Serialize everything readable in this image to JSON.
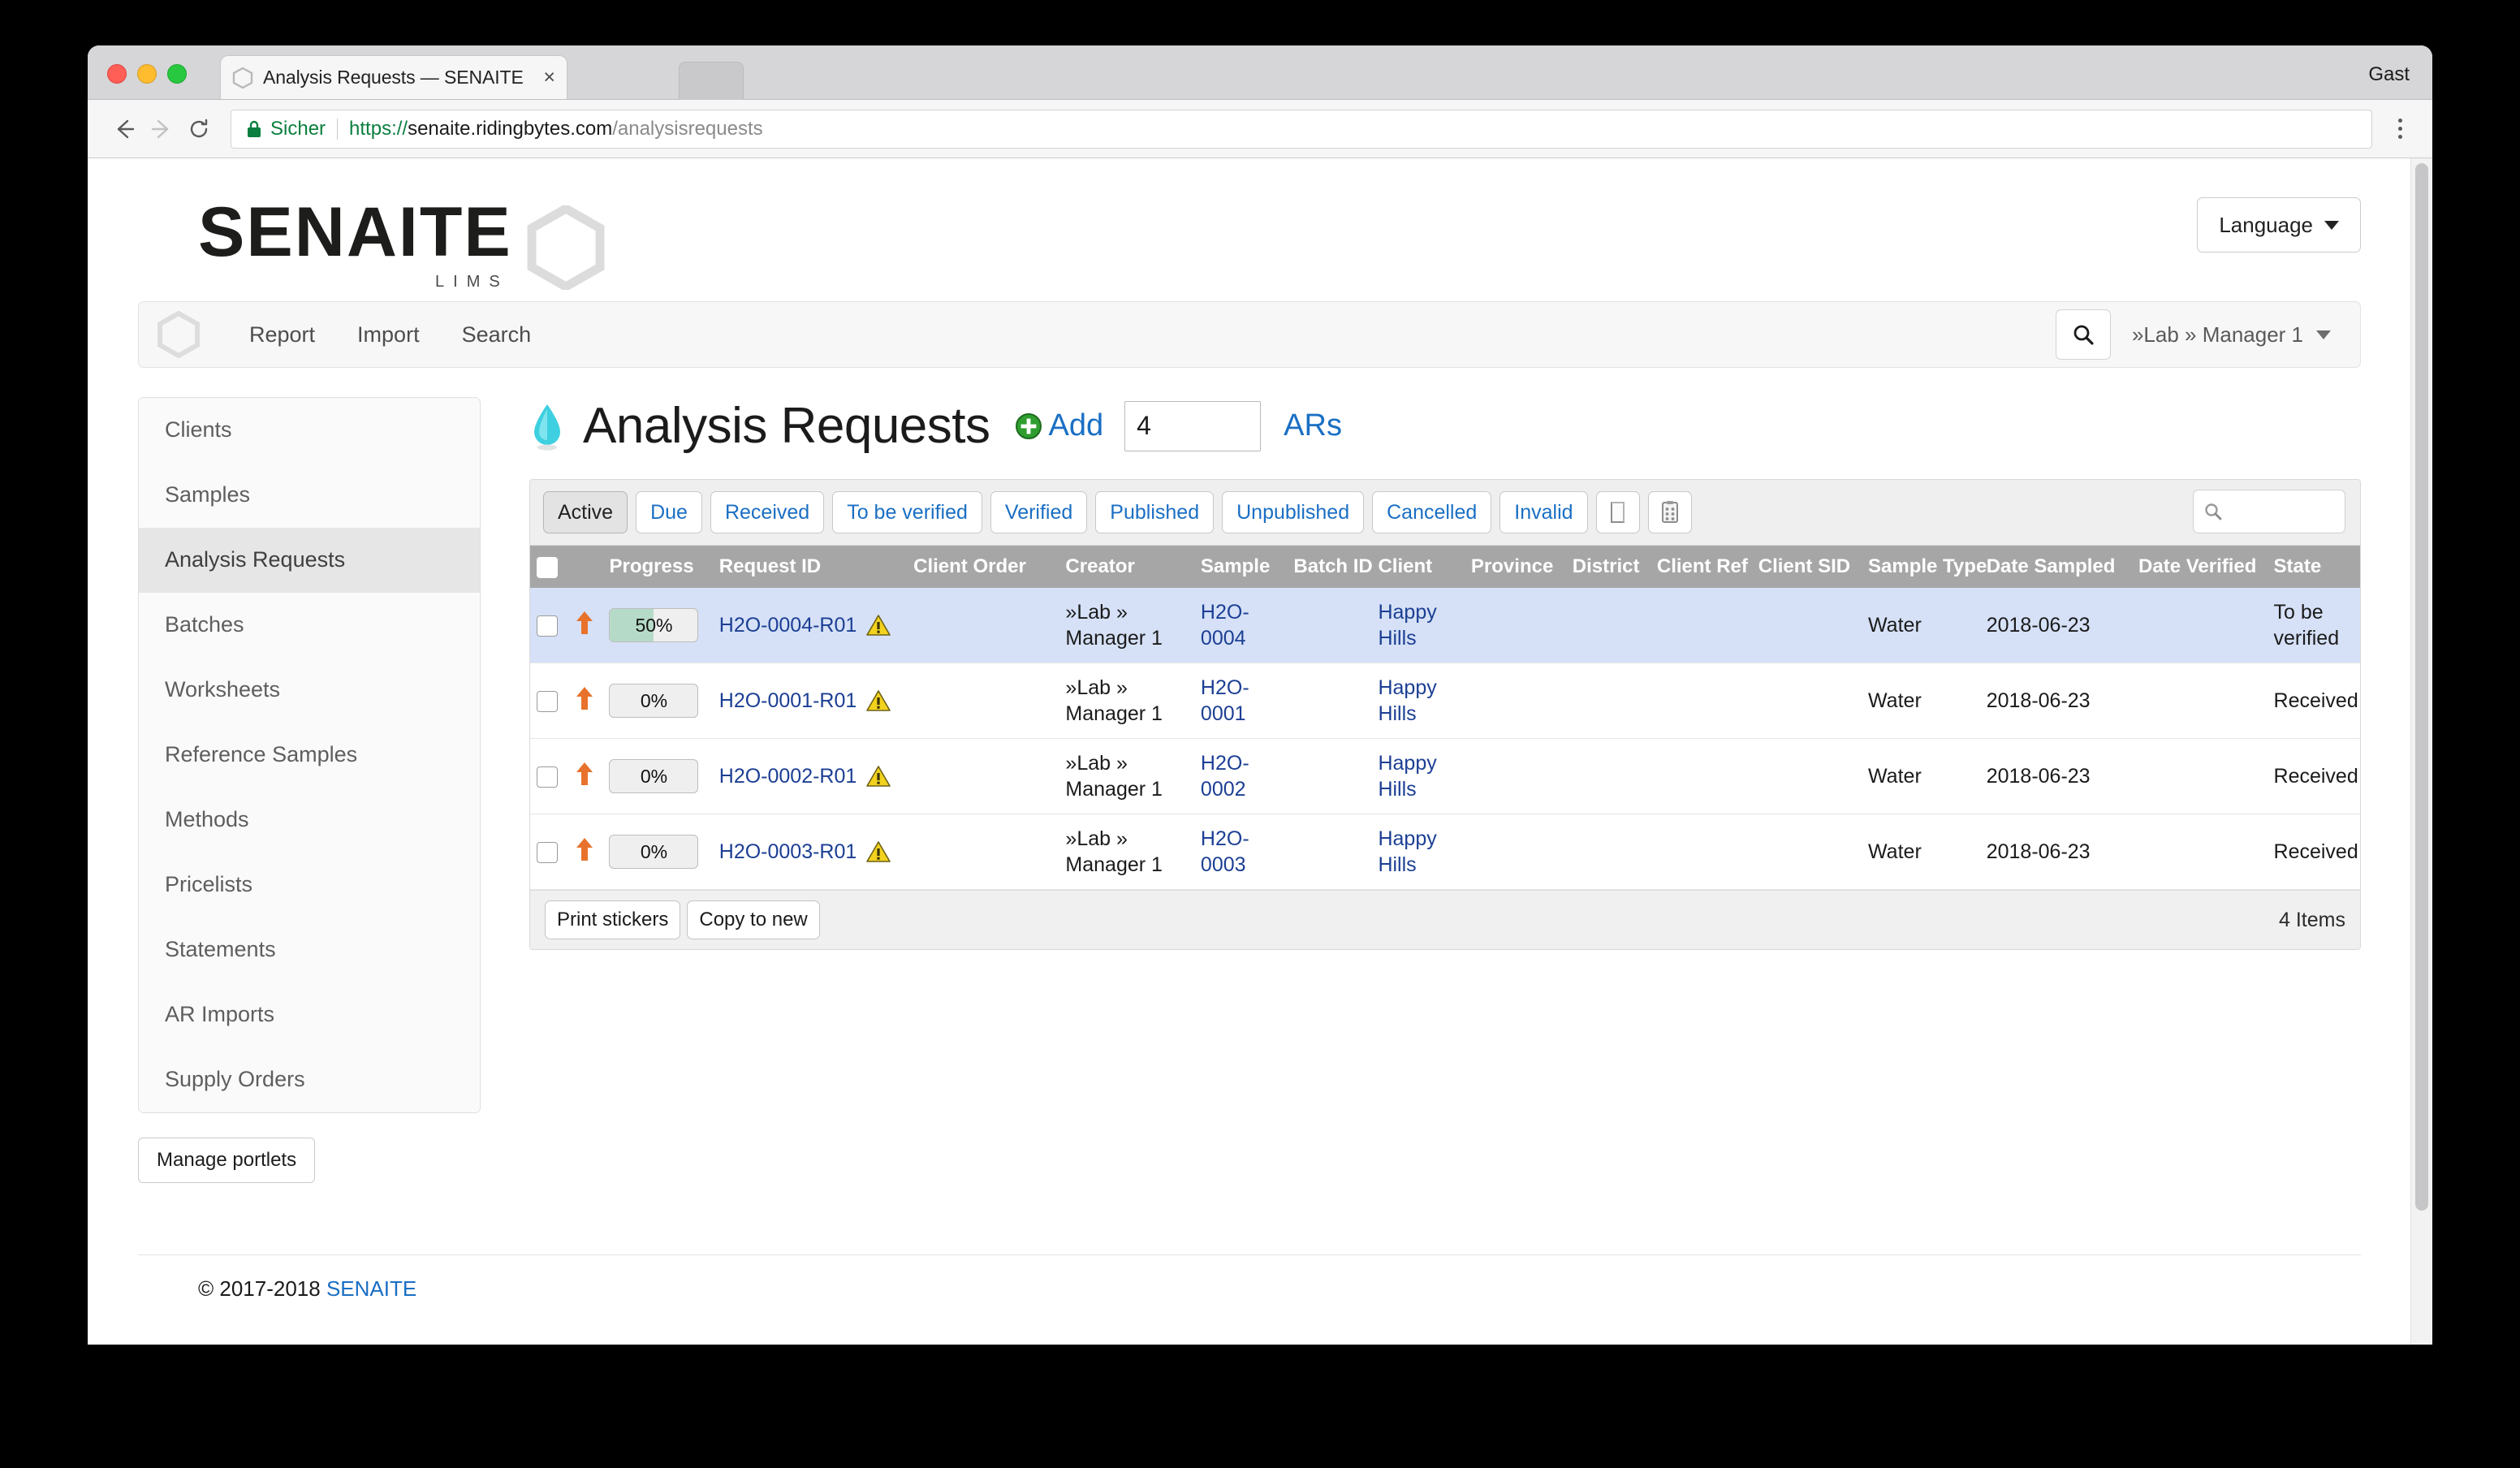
{
  "browser": {
    "tab_title": "Analysis Requests — SENAITE",
    "tab_close": "×",
    "user_label": "Gast",
    "security_label": "Sicher",
    "url_scheme": "https://",
    "url_host": "senaite.ridingbytes.com",
    "url_path": "/analysisrequests"
  },
  "header": {
    "logo_main": "SENAITE",
    "logo_sub": "LIMS",
    "language_button": "Language"
  },
  "nav": {
    "items": [
      {
        "label": "Report"
      },
      {
        "label": "Import"
      },
      {
        "label": "Search"
      }
    ],
    "user_menu": "»Lab » Manager 1"
  },
  "sidebar": {
    "items": [
      {
        "label": "Clients",
        "active": false
      },
      {
        "label": "Samples",
        "active": false
      },
      {
        "label": "Analysis Requests",
        "active": true
      },
      {
        "label": "Batches",
        "active": false
      },
      {
        "label": "Worksheets",
        "active": false
      },
      {
        "label": "Reference Samples",
        "active": false
      },
      {
        "label": "Methods",
        "active": false
      },
      {
        "label": "Pricelists",
        "active": false
      },
      {
        "label": "Statements",
        "active": false
      },
      {
        "label": "AR Imports",
        "active": false
      },
      {
        "label": "Supply Orders",
        "active": false
      }
    ],
    "manage_portlets": "Manage portlets"
  },
  "main": {
    "title": "Analysis Requests",
    "add_label": "Add",
    "ar_count_value": "4",
    "ars_label": "ARs",
    "filters": [
      {
        "label": "Active",
        "active": true
      },
      {
        "label": "Due",
        "active": false
      },
      {
        "label": "Received",
        "active": false
      },
      {
        "label": "To be verified",
        "active": false
      },
      {
        "label": "Verified",
        "active": false
      },
      {
        "label": "Published",
        "active": false
      },
      {
        "label": "Unpublished",
        "active": false
      },
      {
        "label": "Cancelled",
        "active": false
      },
      {
        "label": "Invalid",
        "active": false
      }
    ],
    "search_placeholder": "",
    "search_value": "",
    "columns": [
      "Progress",
      "Request ID",
      "Client Order",
      "Creator",
      "Sample",
      "Batch ID",
      "Client",
      "Province",
      "District",
      "Client Ref",
      "Client SID",
      "Sample Type",
      "Date Sampled",
      "Date Verified",
      "State"
    ],
    "rows": [
      {
        "selected": false,
        "priority": "high",
        "progress": "50%",
        "progress_value": 50,
        "request_id": "H2O-0004-R01",
        "client_order": "",
        "creator": "»Lab » Manager 1",
        "sample": "H2O-0004",
        "batch_id": "",
        "client": "Happy Hills",
        "province": "",
        "district": "",
        "client_ref": "",
        "client_sid": "",
        "sample_type": "Water",
        "date_sampled": "2018-06-23",
        "date_verified": "",
        "state": "To be verified",
        "highlighted": true
      },
      {
        "selected": false,
        "priority": "high",
        "progress": "0%",
        "progress_value": 0,
        "request_id": "H2O-0001-R01",
        "client_order": "",
        "creator": "»Lab » Manager 1",
        "sample": "H2O-0001",
        "batch_id": "",
        "client": "Happy Hills",
        "province": "",
        "district": "",
        "client_ref": "",
        "client_sid": "",
        "sample_type": "Water",
        "date_sampled": "2018-06-23",
        "date_verified": "",
        "state": "Received",
        "highlighted": false
      },
      {
        "selected": false,
        "priority": "high",
        "progress": "0%",
        "progress_value": 0,
        "request_id": "H2O-0002-R01",
        "client_order": "",
        "creator": "»Lab » Manager 1",
        "sample": "H2O-0002",
        "batch_id": "",
        "client": "Happy Hills",
        "province": "",
        "district": "",
        "client_ref": "",
        "client_sid": "",
        "sample_type": "Water",
        "date_sampled": "2018-06-23",
        "date_verified": "",
        "state": "Received",
        "highlighted": false
      },
      {
        "selected": false,
        "priority": "high",
        "progress": "0%",
        "progress_value": 0,
        "request_id": "H2O-0003-R01",
        "client_order": "",
        "creator": "»Lab » Manager 1",
        "sample": "H2O-0003",
        "batch_id": "",
        "client": "Happy Hills",
        "province": "",
        "district": "",
        "client_ref": "",
        "client_sid": "",
        "sample_type": "Water",
        "date_sampled": "2018-06-23",
        "date_verified": "",
        "state": "Received",
        "highlighted": false
      }
    ],
    "footer_buttons": [
      {
        "label": "Print stickers"
      },
      {
        "label": "Copy to new"
      }
    ],
    "items_count": "4 Items"
  },
  "footer": {
    "copyright": "© 2017-2018 ",
    "brand": "SENAITE"
  },
  "colors": {
    "link": "#1a6fc4",
    "row_highlight": "#d6e1f7",
    "header_gray": "#a6a6a6",
    "progress_fill": "#b5dbc8",
    "priority_arrow": "#e8722c",
    "secure_green": "#0b7f3f"
  }
}
